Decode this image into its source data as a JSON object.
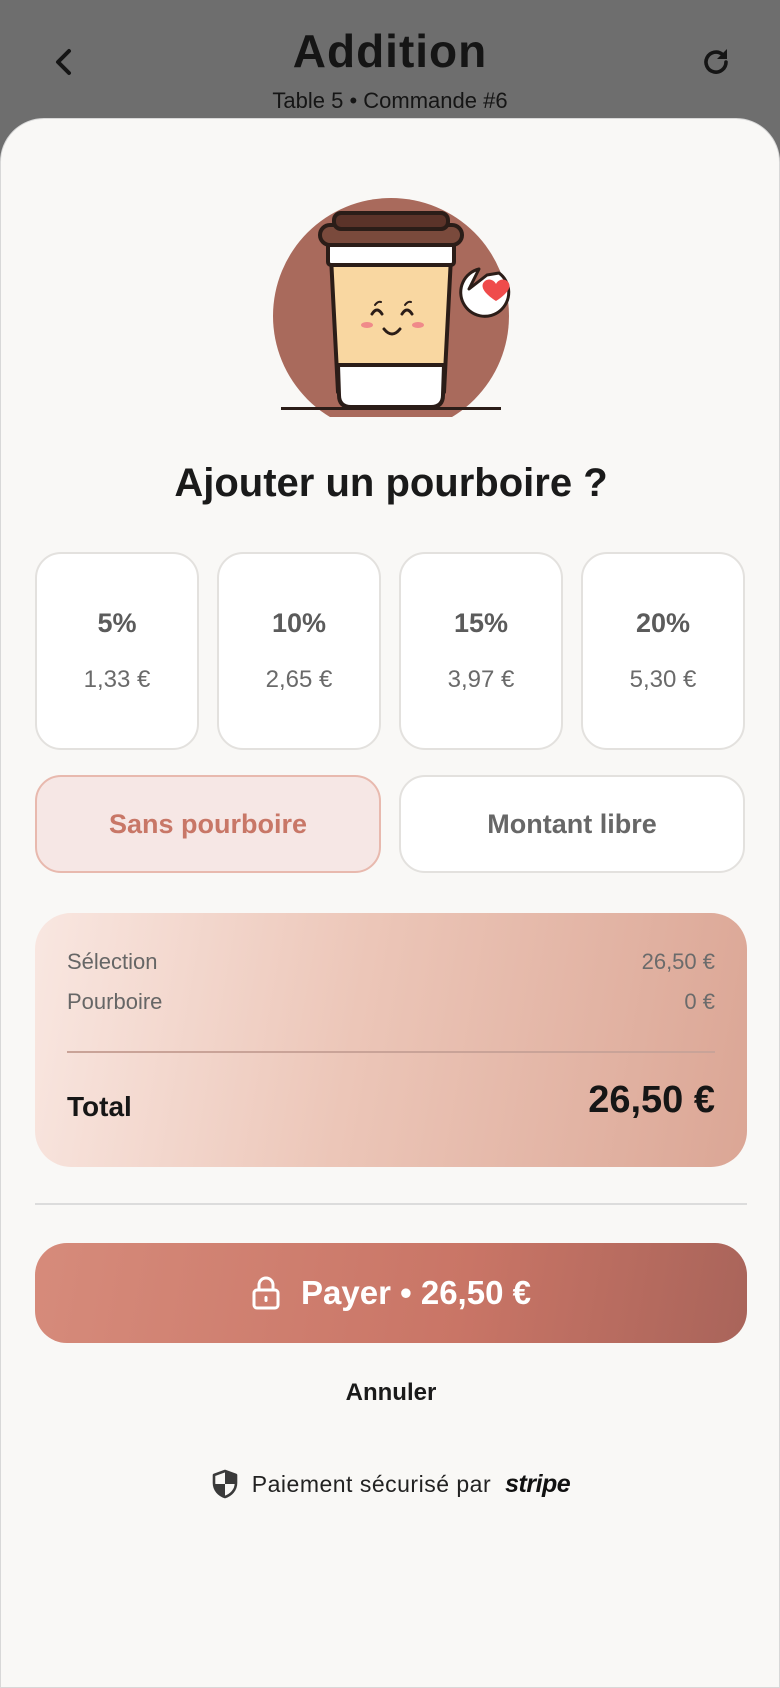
{
  "header": {
    "title": "Addition",
    "subtitle": "Table 5 • Commande #6",
    "back_icon": "chevron-left-icon",
    "refresh_icon": "refresh-icon"
  },
  "tip": {
    "title": "Ajouter un pourboire ?",
    "options": [
      {
        "percent": "5%",
        "amount": "1,33 €"
      },
      {
        "percent": "10%",
        "amount": "2,65 €"
      },
      {
        "percent": "15%",
        "amount": "3,97 €"
      },
      {
        "percent": "20%",
        "amount": "5,30 €"
      }
    ],
    "no_tip_label": "Sans pourboire",
    "custom_label": "Montant libre",
    "selected": "Sans pourboire"
  },
  "summary": {
    "selection_label": "Sélection",
    "selection_value": "26,50 €",
    "tip_label": "Pourboire",
    "tip_value": "0 €",
    "total_label": "Total",
    "total_value": "26,50 €"
  },
  "actions": {
    "pay_label": "Payer • 26,50 €",
    "cancel_label": "Annuler"
  },
  "footer": {
    "secure_text": "Paiement sécurisé par",
    "provider": "stripe"
  },
  "colors": {
    "accent": "#c97566",
    "accent_soft": "#f6e7e5",
    "background": "#f9f8f6",
    "overlay": "#6e6e6e"
  }
}
